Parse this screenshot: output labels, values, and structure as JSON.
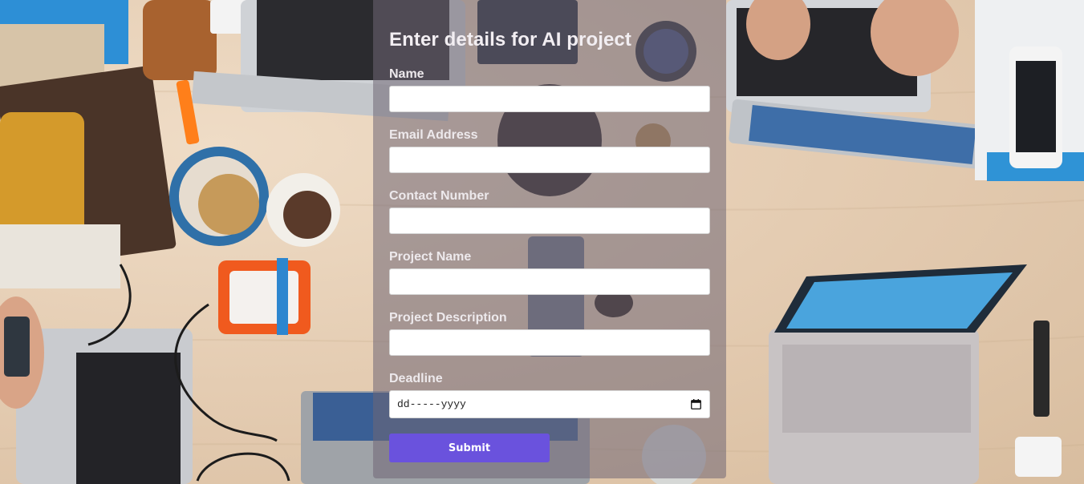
{
  "form": {
    "title": "Enter details for AI project",
    "fields": [
      {
        "label": "Name",
        "value": "",
        "placeholder": ""
      },
      {
        "label": "Email Address",
        "value": "",
        "placeholder": ""
      },
      {
        "label": "Contact Number",
        "value": "",
        "placeholder": ""
      },
      {
        "label": "Project Name",
        "value": "",
        "placeholder": ""
      },
      {
        "label": "Project Description",
        "value": "",
        "placeholder": ""
      }
    ],
    "deadline": {
      "label": "Deadline",
      "value_text": "dd-----yyyy"
    },
    "submit_label": "Submit"
  },
  "colors": {
    "accent": "#6a52dd",
    "panel_overlay": "rgba(112,102,116,0.55)",
    "label_text": "#ede9ec"
  },
  "icons": {
    "date_picker": "calendar-icon"
  }
}
